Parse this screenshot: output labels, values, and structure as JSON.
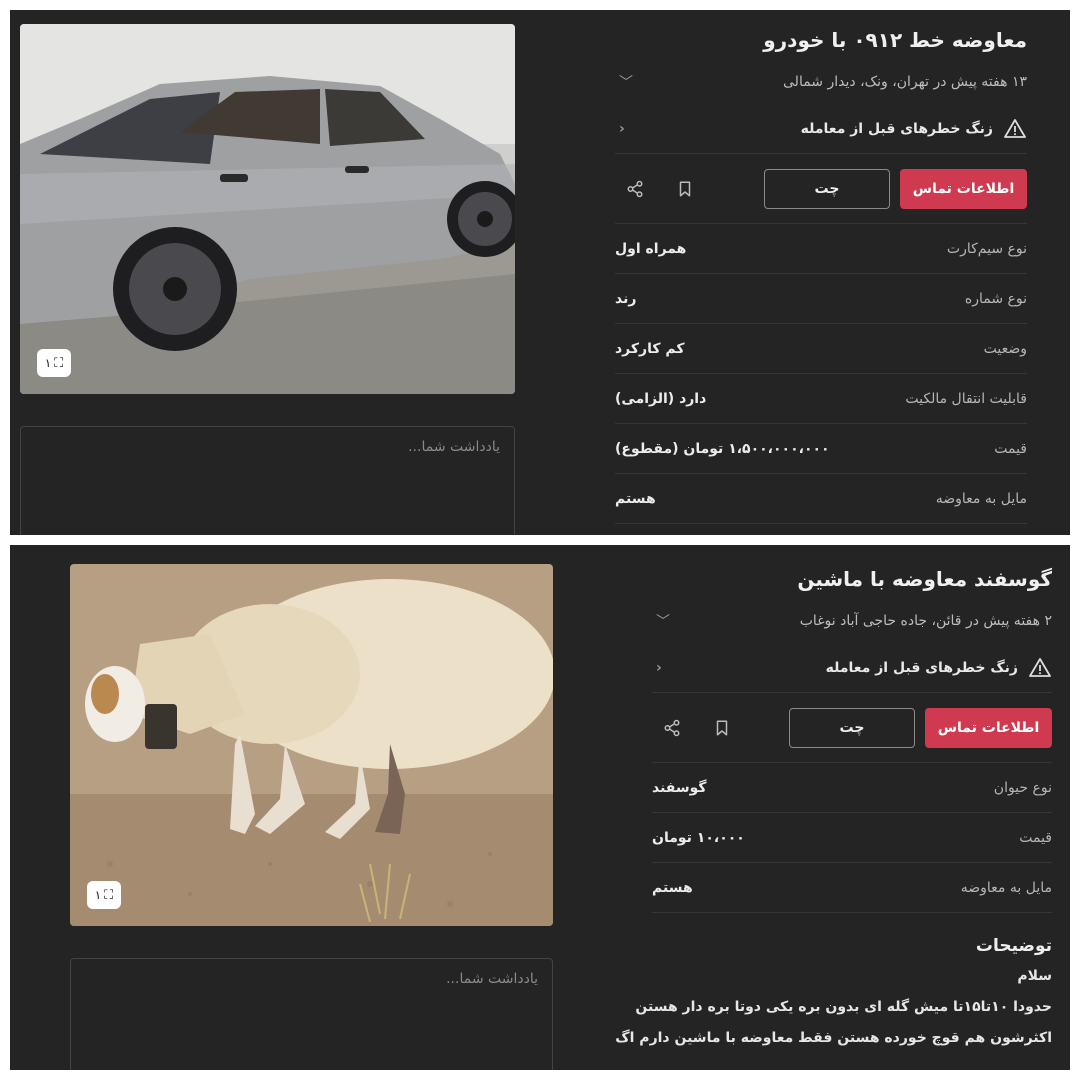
{
  "listings": [
    {
      "title": "معاوضه خط ۰۹۱۲ با خودرو",
      "meta": "۱۳ هفته پیش در تهران، ونک، دیدار شمالی",
      "warning": "زنگ خطرهای قبل از معامله",
      "contact_label": "اطلاعات تماس",
      "chat_label": "چت",
      "note_placeholder": "یادداشت شما...",
      "gallery_count": "۱",
      "image_icon": "car-photo",
      "attributes": [
        {
          "key": "نوع سیم‌کارت",
          "value": "همراه اول"
        },
        {
          "key": "نوع شماره",
          "value": "رند"
        },
        {
          "key": "وضعیت",
          "value": "کم کارکرد"
        },
        {
          "key": "قابلیت انتقال مالکیت",
          "value": "دارد (الزامی)"
        },
        {
          "key": "قیمت",
          "value": "۱،۵۰۰،۰۰۰،۰۰۰ تومان (مقطوع)"
        },
        {
          "key": "مایل به معاوضه",
          "value": "هستم"
        }
      ]
    },
    {
      "title": "گوسفند معاوضه با ماشین",
      "meta": "۲ هفته پیش در قائن، جاده حاجی آباد نوغاب",
      "warning": "زنگ خطرهای قبل از معامله",
      "contact_label": "اطلاعات تماس",
      "chat_label": "چت",
      "note_placeholder": "یادداشت شما...",
      "gallery_count": "۱",
      "image_icon": "sheep-photo",
      "attributes": [
        {
          "key": "نوع حیوان",
          "value": "گوسفند"
        },
        {
          "key": "قیمت",
          "value": "۱۰،۰۰۰ تومان"
        },
        {
          "key": "مایل به معاوضه",
          "value": "هستم"
        }
      ],
      "description_title": "توضیحات",
      "description_lines": [
        "سلام",
        "حدودا ۱۰تا۱۵تا میش گله ای بدون بره یکی دوتا بره دار هستن",
        "اکثرشون هم قوچ خورده هستن فقط معاوضه با ماشین دارم اگ"
      ]
    }
  ],
  "colors": {
    "panel_bg": "#242424",
    "accent": "#cf3a51",
    "divider": "#363636"
  }
}
